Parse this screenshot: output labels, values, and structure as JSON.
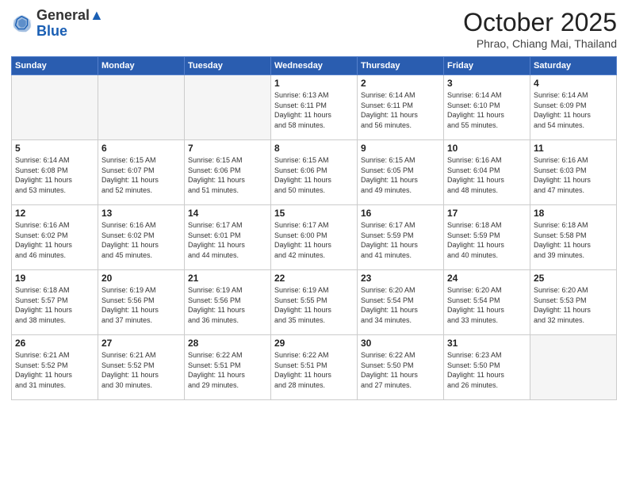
{
  "header": {
    "logo_general": "General",
    "logo_blue": "Blue",
    "month": "October 2025",
    "location": "Phrao, Chiang Mai, Thailand"
  },
  "days_of_week": [
    "Sunday",
    "Monday",
    "Tuesday",
    "Wednesday",
    "Thursday",
    "Friday",
    "Saturday"
  ],
  "weeks": [
    [
      {
        "num": "",
        "info": "",
        "empty": true
      },
      {
        "num": "",
        "info": "",
        "empty": true
      },
      {
        "num": "",
        "info": "",
        "empty": true
      },
      {
        "num": "1",
        "info": "Sunrise: 6:13 AM\nSunset: 6:11 PM\nDaylight: 11 hours\nand 58 minutes."
      },
      {
        "num": "2",
        "info": "Sunrise: 6:14 AM\nSunset: 6:11 PM\nDaylight: 11 hours\nand 56 minutes."
      },
      {
        "num": "3",
        "info": "Sunrise: 6:14 AM\nSunset: 6:10 PM\nDaylight: 11 hours\nand 55 minutes."
      },
      {
        "num": "4",
        "info": "Sunrise: 6:14 AM\nSunset: 6:09 PM\nDaylight: 11 hours\nand 54 minutes."
      }
    ],
    [
      {
        "num": "5",
        "info": "Sunrise: 6:14 AM\nSunset: 6:08 PM\nDaylight: 11 hours\nand 53 minutes."
      },
      {
        "num": "6",
        "info": "Sunrise: 6:15 AM\nSunset: 6:07 PM\nDaylight: 11 hours\nand 52 minutes."
      },
      {
        "num": "7",
        "info": "Sunrise: 6:15 AM\nSunset: 6:06 PM\nDaylight: 11 hours\nand 51 minutes."
      },
      {
        "num": "8",
        "info": "Sunrise: 6:15 AM\nSunset: 6:06 PM\nDaylight: 11 hours\nand 50 minutes."
      },
      {
        "num": "9",
        "info": "Sunrise: 6:15 AM\nSunset: 6:05 PM\nDaylight: 11 hours\nand 49 minutes."
      },
      {
        "num": "10",
        "info": "Sunrise: 6:16 AM\nSunset: 6:04 PM\nDaylight: 11 hours\nand 48 minutes."
      },
      {
        "num": "11",
        "info": "Sunrise: 6:16 AM\nSunset: 6:03 PM\nDaylight: 11 hours\nand 47 minutes."
      }
    ],
    [
      {
        "num": "12",
        "info": "Sunrise: 6:16 AM\nSunset: 6:02 PM\nDaylight: 11 hours\nand 46 minutes."
      },
      {
        "num": "13",
        "info": "Sunrise: 6:16 AM\nSunset: 6:02 PM\nDaylight: 11 hours\nand 45 minutes."
      },
      {
        "num": "14",
        "info": "Sunrise: 6:17 AM\nSunset: 6:01 PM\nDaylight: 11 hours\nand 44 minutes."
      },
      {
        "num": "15",
        "info": "Sunrise: 6:17 AM\nSunset: 6:00 PM\nDaylight: 11 hours\nand 42 minutes."
      },
      {
        "num": "16",
        "info": "Sunrise: 6:17 AM\nSunset: 5:59 PM\nDaylight: 11 hours\nand 41 minutes."
      },
      {
        "num": "17",
        "info": "Sunrise: 6:18 AM\nSunset: 5:59 PM\nDaylight: 11 hours\nand 40 minutes."
      },
      {
        "num": "18",
        "info": "Sunrise: 6:18 AM\nSunset: 5:58 PM\nDaylight: 11 hours\nand 39 minutes."
      }
    ],
    [
      {
        "num": "19",
        "info": "Sunrise: 6:18 AM\nSunset: 5:57 PM\nDaylight: 11 hours\nand 38 minutes."
      },
      {
        "num": "20",
        "info": "Sunrise: 6:19 AM\nSunset: 5:56 PM\nDaylight: 11 hours\nand 37 minutes."
      },
      {
        "num": "21",
        "info": "Sunrise: 6:19 AM\nSunset: 5:56 PM\nDaylight: 11 hours\nand 36 minutes."
      },
      {
        "num": "22",
        "info": "Sunrise: 6:19 AM\nSunset: 5:55 PM\nDaylight: 11 hours\nand 35 minutes."
      },
      {
        "num": "23",
        "info": "Sunrise: 6:20 AM\nSunset: 5:54 PM\nDaylight: 11 hours\nand 34 minutes."
      },
      {
        "num": "24",
        "info": "Sunrise: 6:20 AM\nSunset: 5:54 PM\nDaylight: 11 hours\nand 33 minutes."
      },
      {
        "num": "25",
        "info": "Sunrise: 6:20 AM\nSunset: 5:53 PM\nDaylight: 11 hours\nand 32 minutes."
      }
    ],
    [
      {
        "num": "26",
        "info": "Sunrise: 6:21 AM\nSunset: 5:52 PM\nDaylight: 11 hours\nand 31 minutes."
      },
      {
        "num": "27",
        "info": "Sunrise: 6:21 AM\nSunset: 5:52 PM\nDaylight: 11 hours\nand 30 minutes."
      },
      {
        "num": "28",
        "info": "Sunrise: 6:22 AM\nSunset: 5:51 PM\nDaylight: 11 hours\nand 29 minutes."
      },
      {
        "num": "29",
        "info": "Sunrise: 6:22 AM\nSunset: 5:51 PM\nDaylight: 11 hours\nand 28 minutes."
      },
      {
        "num": "30",
        "info": "Sunrise: 6:22 AM\nSunset: 5:50 PM\nDaylight: 11 hours\nand 27 minutes."
      },
      {
        "num": "31",
        "info": "Sunrise: 6:23 AM\nSunset: 5:50 PM\nDaylight: 11 hours\nand 26 minutes."
      },
      {
        "num": "",
        "info": "",
        "empty": true
      }
    ]
  ]
}
